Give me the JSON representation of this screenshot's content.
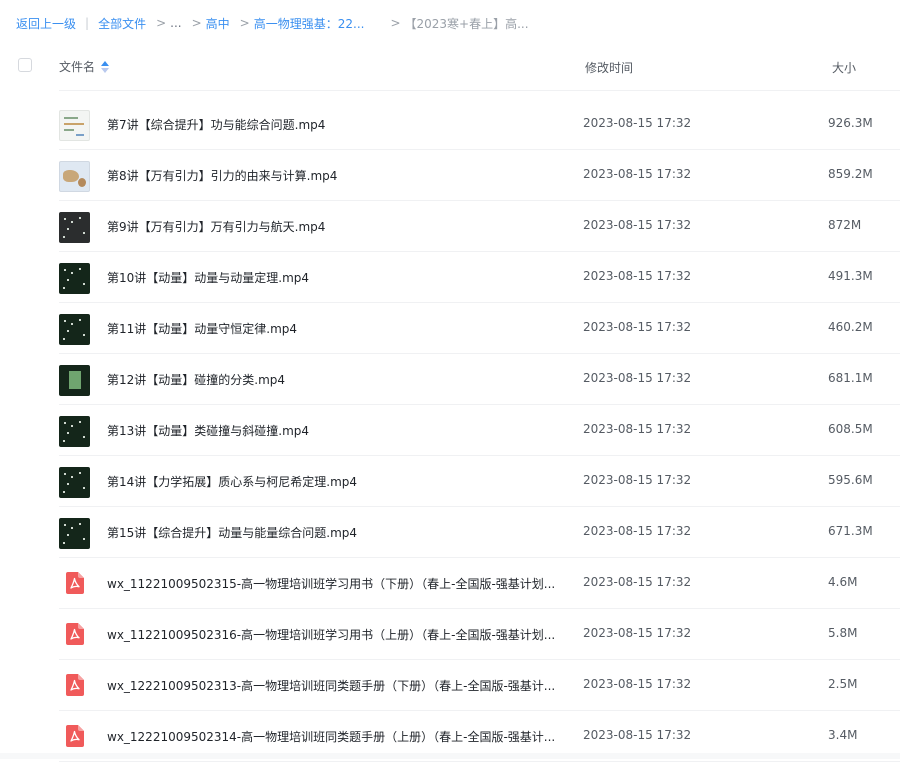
{
  "breadcrumb": {
    "back": "返回上一级",
    "all_files": "全部文件",
    "ellipsis": "...",
    "level1": "高中",
    "level2": "高一物理强基：22...",
    "current": "【2023寒+春上】高..."
  },
  "header": {
    "name": "文件名",
    "time": "修改时间",
    "size": "大小"
  },
  "files": [
    {
      "name": "第7讲【综合提升】功与能综合问题.mp4",
      "time": "2023-08-15 17:32",
      "size": "926.3M",
      "type": "video",
      "thumb": "light"
    },
    {
      "name": "第8讲【万有引力】引力的由来与计算.mp4",
      "time": "2023-08-15 17:32",
      "size": "859.2M",
      "type": "video",
      "thumb": "map"
    },
    {
      "name": "第9讲【万有引力】万有引力与航天.mp4",
      "time": "2023-08-15 17:32",
      "size": "872M",
      "type": "video",
      "thumb": "gray"
    },
    {
      "name": "第10讲【动量】动量与动量定理.mp4",
      "time": "2023-08-15 17:32",
      "size": "491.3M",
      "type": "video",
      "thumb": "dark"
    },
    {
      "name": "第11讲【动量】动量守恒定律.mp4",
      "time": "2023-08-15 17:32",
      "size": "460.2M",
      "type": "video",
      "thumb": "dark"
    },
    {
      "name": "第12讲【动量】碰撞的分类.mp4",
      "time": "2023-08-15 17:32",
      "size": "681.1M",
      "type": "video",
      "thumb": "board"
    },
    {
      "name": "第13讲【动量】类碰撞与斜碰撞.mp4",
      "time": "2023-08-15 17:32",
      "size": "608.5M",
      "type": "video",
      "thumb": "dark"
    },
    {
      "name": "第14讲【力学拓展】质心系与柯尼希定理.mp4",
      "time": "2023-08-15 17:32",
      "size": "595.6M",
      "type": "video",
      "thumb": "dark"
    },
    {
      "name": "第15讲【综合提升】动量与能量综合问题.mp4",
      "time": "2023-08-15 17:32",
      "size": "671.3M",
      "type": "video",
      "thumb": "dark"
    },
    {
      "name": "wx_11221009502315-高一物理培训班学习用书（下册）（春上-全国版-强基计划...",
      "time": "2023-08-15 17:32",
      "size": "4.6M",
      "type": "pdf"
    },
    {
      "name": "wx_11221009502316-高一物理培训班学习用书（上册）（春上-全国版-强基计划...",
      "time": "2023-08-15 17:32",
      "size": "5.8M",
      "type": "pdf"
    },
    {
      "name": "wx_12221009502313-高一物理培训班同类题手册（下册）（春上-全国版-强基计...",
      "time": "2023-08-15 17:32",
      "size": "2.5M",
      "type": "pdf"
    },
    {
      "name": "wx_12221009502314-高一物理培训班同类题手册（上册）（春上-全国版-强基计...",
      "time": "2023-08-15 17:32",
      "size": "3.4M",
      "type": "pdf"
    }
  ],
  "colors": {
    "link": "#3a8ff0",
    "pdf": "#f05a5a",
    "text": "#1f2329",
    "muted": "#555b63"
  },
  "icons": {
    "sort": "sort-ascending-icon",
    "pdf": "pdf-file-icon",
    "video": "video-thumbnail"
  }
}
